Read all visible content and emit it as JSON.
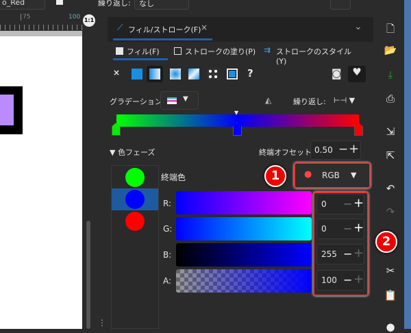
{
  "topbar": {
    "object_name": "o_Red",
    "repeat_label": "繰り返し:",
    "repeat_value": "なし"
  },
  "ruler": {
    "ticks": [
      "75",
      "100"
    ],
    "zoom_button": "1:1"
  },
  "panel": {
    "tab_title": "フィル/ストローク(F)",
    "subtabs": [
      "フィル(F)",
      "ストロークの塗り(P)",
      "ストロークのスタイル(Y)"
    ],
    "paint_types": [
      "none",
      "flat",
      "linear",
      "radial",
      "mesh",
      "pattern",
      "swatch",
      "unset"
    ],
    "unset_label": "?",
    "gradient_label": "グラデーション:",
    "repeat_label": "繰り返し:",
    "gradient_stops": [
      "#00ff00",
      "#0000ff",
      "#ff0000"
    ],
    "color_phase_label": "色フェーズ",
    "end_offset_label": "終端オフセット:",
    "end_offset_value": "0.50",
    "end_color_label": "終端色",
    "color_mode": "RGB",
    "channels": [
      {
        "label": "R:",
        "value": "0"
      },
      {
        "label": "G:",
        "value": "0"
      },
      {
        "label": "B:",
        "value": "255"
      },
      {
        "label": "A:",
        "value": "100"
      }
    ]
  },
  "annotations": [
    "1",
    "2"
  ],
  "toolbar": {
    "icons": [
      "new-document",
      "open",
      "save",
      "print",
      "import",
      "export",
      "undo",
      "redo",
      "cut",
      "paste"
    ]
  }
}
